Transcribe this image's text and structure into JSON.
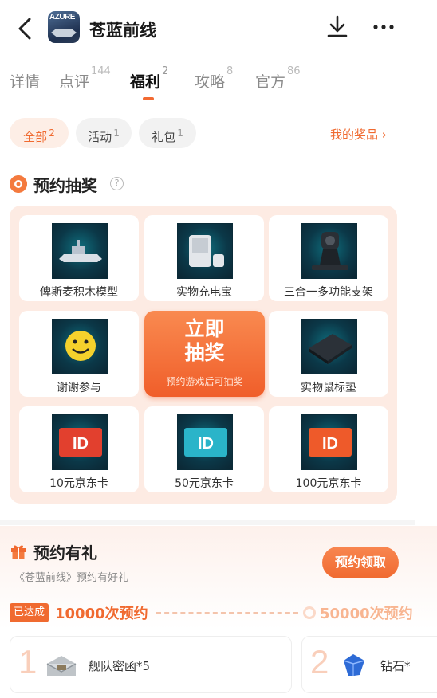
{
  "header": {
    "title": "苍蓝前线",
    "game_icon_text": "AZURE"
  },
  "tabs": [
    {
      "label": "详情",
      "count": ""
    },
    {
      "label": "点评",
      "count": "144"
    },
    {
      "label": "福利",
      "count": "2"
    },
    {
      "label": "攻略",
      "count": "8"
    },
    {
      "label": "官方",
      "count": "86"
    }
  ],
  "filters": [
    {
      "label": "全部",
      "count": "2"
    },
    {
      "label": "活动",
      "count": "1"
    },
    {
      "label": "礼包",
      "count": "1"
    }
  ],
  "my_prizes": "我的奖品",
  "lottery": {
    "title": "预约抽奖",
    "help": "?",
    "prizes": [
      "俾斯麦积木模型",
      "实物充电宝",
      "三合一多功能支架",
      "谢谢参与",
      "实物鼠标垫",
      "10元京东卡",
      "50元京东卡",
      "100元京东卡"
    ],
    "draw_line1": "立即",
    "draw_line2": "抽奖",
    "draw_sub": "预约游戏后可抽奖",
    "card_values": [
      "10",
      "50",
      "100"
    ]
  },
  "reserve": {
    "title": "预约有礼",
    "subtitle": "《苍蓝前线》预约有好礼",
    "claim": "预约领取",
    "reached": "已达成",
    "milestone1": "10000次预约",
    "milestone2": "50000次预约",
    "rewards": [
      {
        "num": "1",
        "label": "舰队密函*5"
      },
      {
        "num": "2",
        "label": "钻石*"
      }
    ]
  },
  "colors": {
    "accent": "#f06a30",
    "accent_light": "#fdebe3"
  }
}
